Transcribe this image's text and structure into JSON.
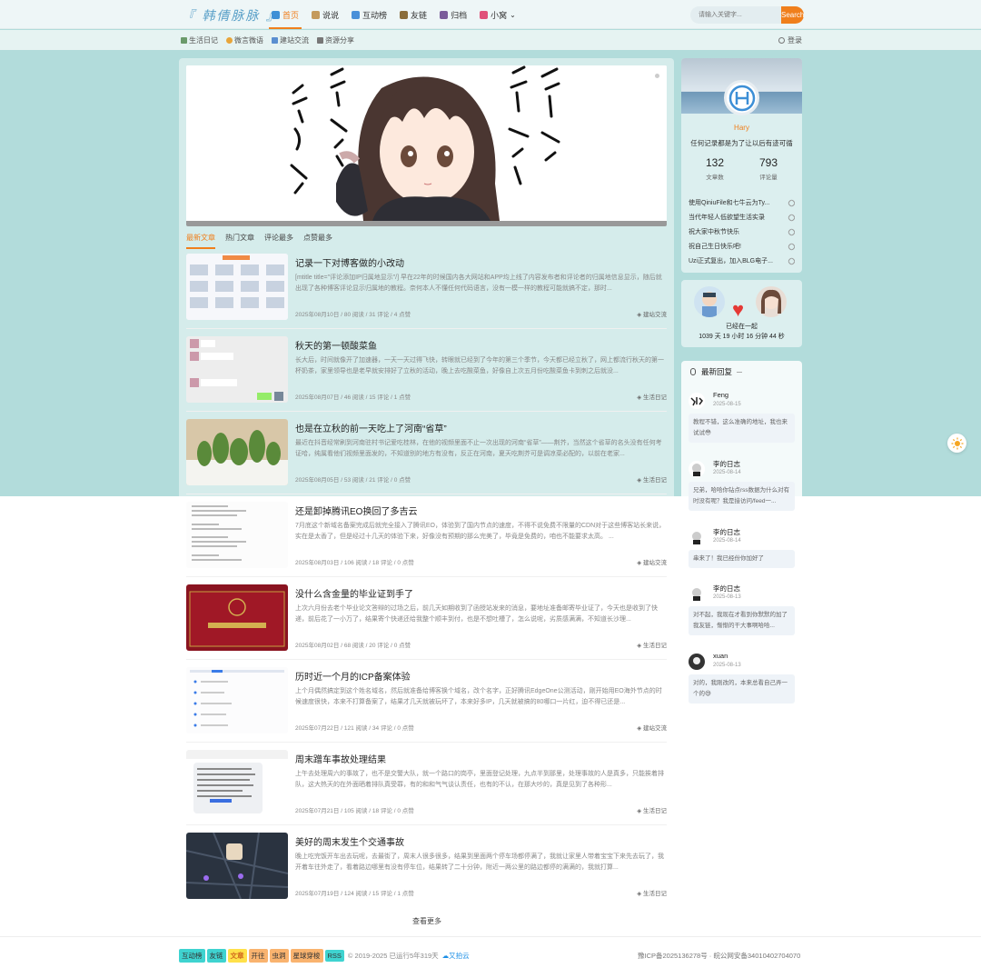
{
  "header": {
    "logo": "『 韩倩脉脉 』",
    "nav": [
      {
        "label": "首页",
        "icon": "home-icon",
        "color": "#3d8fd6"
      },
      {
        "label": "说说",
        "icon": "hourglass-icon",
        "color": "#c49a5c"
      },
      {
        "label": "互动榜",
        "icon": "rank-icon",
        "color": "#4a90d9"
      },
      {
        "label": "友链",
        "icon": "link-icon",
        "color": "#8a6d3b"
      },
      {
        "label": "归档",
        "icon": "book-icon",
        "color": "#7a5c9a"
      },
      {
        "label": "小窝",
        "icon": "heart-icon",
        "color": "#e0517a"
      }
    ],
    "search_placeholder": "请输入关键字...",
    "search_button": "Search"
  },
  "subnav": {
    "items": [
      {
        "label": "生活日记",
        "color": "#6b9a6b"
      },
      {
        "label": "微言微语",
        "color": "#e8a53a"
      },
      {
        "label": "建站交流",
        "color": "#5a8fd0"
      },
      {
        "label": "资源分享",
        "color": "#777777"
      }
    ],
    "login": "登录"
  },
  "tabs": [
    "最新文章",
    "热门文章",
    "评论最多",
    "点赞最多"
  ],
  "posts": [
    {
      "title": "记录一下对博客做的小改动",
      "excerpt": "[mtitle title=\"评论添加IP归属地显示\"/] 早在22年的时候国内各大网站和APP均上线了内容发布者和评论者的归属地信息显示，随后就出现了各种博客评论显示归属地的教程。奈何本人不懂任何代码语言，没有一模一样的教程可能就搞不定，那时...",
      "meta": "2025年08月10日 / 80 阅读 / 31 评论 / 4 点赞",
      "cat": "建站交流"
    },
    {
      "title": "秋天的第一顿酸菜鱼",
      "excerpt": "长大后，时间就像开了加速器，一天一天过得飞快，转眼就已经到了今年的第三个季节，今天都已经立秋了，网上都流行秋天的第一杯奶茶，家里领导也是老早就安排好了立秋的活动，晚上去吃酸菜鱼，好像自上次五月份吃酸菜鱼卡到刺之后就没...",
      "meta": "2025年08月07日 / 46 阅读 / 15 评论 / 1 点赞",
      "cat": "生活日记"
    },
    {
      "title": "也是在立秋的前一天吃上了河南“省草”",
      "excerpt": "最近在抖音经常刷到河南驻村书记爱吃桂林，在他的视频里面不止一次出现的河南“省草”——荆芥，当然这个省草的名头没有任何考证哈，纯属看他们视频里面发的，不知道别的地方有没有，反正在河南，夏天吃荆芥可是调凉菜必配的，以前在老家...",
      "meta": "2025年08月05日 / 53 阅读 / 21 评论 / 0 点赞",
      "cat": "生活日记"
    },
    {
      "title": "还是卸掉腾讯EO换回了多吉云",
      "excerpt": "7月底这个新域名备案完成后就完全接入了腾讯EO，体验到了国内节点的速度，不得不说免费不限量的CDN对于这些博客站长来说，实在是太香了，但是经过十几天的体验下来，好像没有预期的那么完美了，毕竟是免费的，咱也不能要求太高。 ...",
      "meta": "2025年08月03日 / 106 阅读 / 18 评论 / 0 点赞",
      "cat": "建站交流"
    },
    {
      "title": "没什么含金量的毕业证到手了",
      "excerpt": "上次六月份去老个毕业论文答辩的过场之后，前几天如期收到了函授站发来的消息，要地址准备邮寄毕业证了，今天也是收到了快递，前后花了一小万了，结果寄个快递还给我整个顺丰到付，也是不想吐槽了，怎么说呢，劣质感满满，不知道长沙理...",
      "meta": "2025年08月02日 / 68 阅读 / 20 评论 / 0 点赞",
      "cat": "生活日记"
    },
    {
      "title": "历时近一个月的ICP备案体验",
      "excerpt": "上个月偶然搞定到这个姓名域名，然后就准备给博客换个域名，改个名字，正好腾讯EdgeOne公测活动，刚开始用EO海外节点的时候速度很快，本来不打算备案了，结果才几天就被玩坏了，本来好多IP，几天就被搞的80哪口一片红，迫不得已还是...",
      "meta": "2025年07月22日 / 121 阅读 / 34 评论 / 0 点赞",
      "cat": "建站交流"
    },
    {
      "title": "周末蹭车事故处理结果",
      "excerpt": "上午去处理周六的事故了，也不是交警大队，就一个路口的岗亭，里面登记处理，九点半到那里，处理事故的人是真多，只能挨着排队，这大热天的在外面晒着排队真受罪，有的和和气气谈认责任，也有的不认，在那大吵的，真是见到了各种形...",
      "meta": "2025年07月21日 / 105 阅读 / 18 评论 / 0 点赞",
      "cat": "生活日记"
    },
    {
      "title": "美好的周末发生个交通事故",
      "excerpt": "晚上吃完饭开车出去玩呢，去最街了，周末人很多很多，结果到里面两个停车场都停满了，我就让家里人带着宝宝下来先去玩了，我开着车往外走了，看着路边哪里有没有停车位，结果转了二十分钟，附近一两公里的路边都停的满满的，我就打算...",
      "meta": "2025年07月19日 / 124 阅读 / 15 评论 / 1 点赞",
      "cat": "生活日记"
    }
  ],
  "load_more": "查看更多",
  "profile": {
    "name": "Hary",
    "desc": "任何记录都是为了让以后有迹可循",
    "stats": [
      {
        "n": "132",
        "l": "文章数"
      },
      {
        "n": "793",
        "l": "评论量"
      }
    ],
    "links": [
      "使用QiniuFile和七牛云为Ty...",
      "当代年轻人低欲望生活实录",
      "祝大家中秋节快乐",
      "祝自己生日快乐吧!",
      "Uzi正式复出，加入BLG电子..."
    ]
  },
  "together": {
    "line1": "已经在一起",
    "line2": "1039 天 19 小时 16 分钟 44 秒"
  },
  "comments": {
    "title": "最新回复",
    "items": [
      {
        "name": "Feng",
        "date": "2025-08-15",
        "text": "教程不错，这么准确的地址，我也来试试😳"
      },
      {
        "name": "李的日志",
        "date": "2025-08-14",
        "text": "兄弟，哈哈你钻点rss数据为什么对有时没有呢？我是接访问/feed一..."
      },
      {
        "name": "李的日志",
        "date": "2025-08-14",
        "text": "串来了！我已经份你加好了"
      },
      {
        "name": "李的日志",
        "date": "2025-08-13",
        "text": "对不起，我现在才看到你默默的加了我友链，惭惭的干大事啊哈哈..."
      },
      {
        "name": "xuan",
        "date": "2025-08-13",
        "text": "对的，我刚改的，本来总看自己弄一个的😅"
      }
    ]
  },
  "footer": {
    "badges": [
      {
        "label": "互动榜",
        "color": "#3fd3d0"
      },
      {
        "label": "友链",
        "color": "#3fd3d0"
      },
      {
        "label": "文章",
        "color": "#ffe14a"
      },
      {
        "label": "开往",
        "color": "#f9b36f"
      },
      {
        "label": "虫洞",
        "color": "#f9b36f"
      },
      {
        "label": "星球穿梭",
        "color": "#f9b36f"
      },
      {
        "label": "RSS",
        "color": "#3fd3d0"
      }
    ],
    "copyright": "© 2019-2025 已运行5年319天",
    "cloud": "又拍云",
    "icp": "豫ICP备2025136278号 · 皖公网安备34010402704070"
  }
}
